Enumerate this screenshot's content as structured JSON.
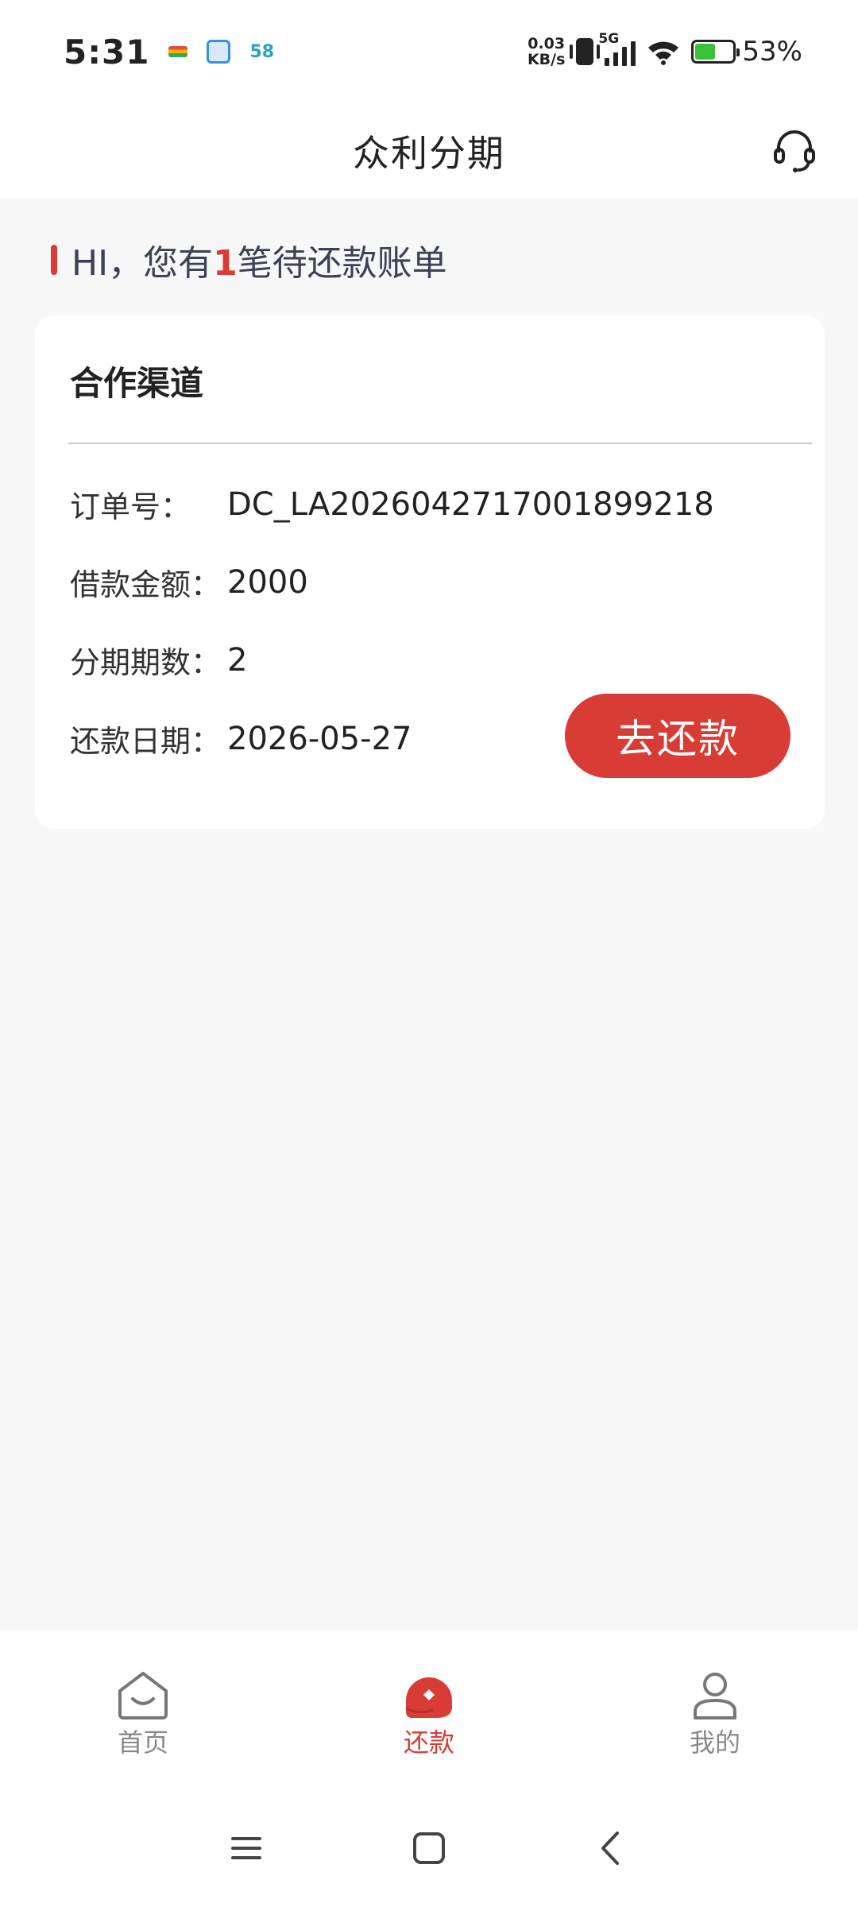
{
  "status_bar": {
    "time": "5:31",
    "notif_c": "58",
    "net_speed_value": "0.03",
    "net_speed_unit": "KB/s",
    "network_type": "5G",
    "battery_percent": "53%",
    "battery_level": 0.53
  },
  "header": {
    "title": "众利分期"
  },
  "greeting": {
    "prefix": "HI，您有",
    "count": "1",
    "suffix": "笔待还款账单"
  },
  "card": {
    "title": "合作渠道",
    "rows": [
      {
        "label": "订单号：",
        "value": "DC_LA202604271700189​9218"
      },
      {
        "label": "借款金额：",
        "value": "2000"
      },
      {
        "label": "分期期数：",
        "value": "2"
      },
      {
        "label": "还款日期：",
        "value": "2026-05-27"
      }
    ],
    "repay_button": "去还款"
  },
  "bottom_nav": {
    "items": [
      {
        "label": "首页",
        "icon": "home-icon",
        "active": false
      },
      {
        "label": "还款",
        "icon": "repay-icon",
        "active": true
      },
      {
        "label": "我的",
        "icon": "profile-icon",
        "active": false
      }
    ]
  },
  "colors": {
    "accent": "#d93c35",
    "background": "#f7f7f7",
    "text_muted": "#888888"
  }
}
